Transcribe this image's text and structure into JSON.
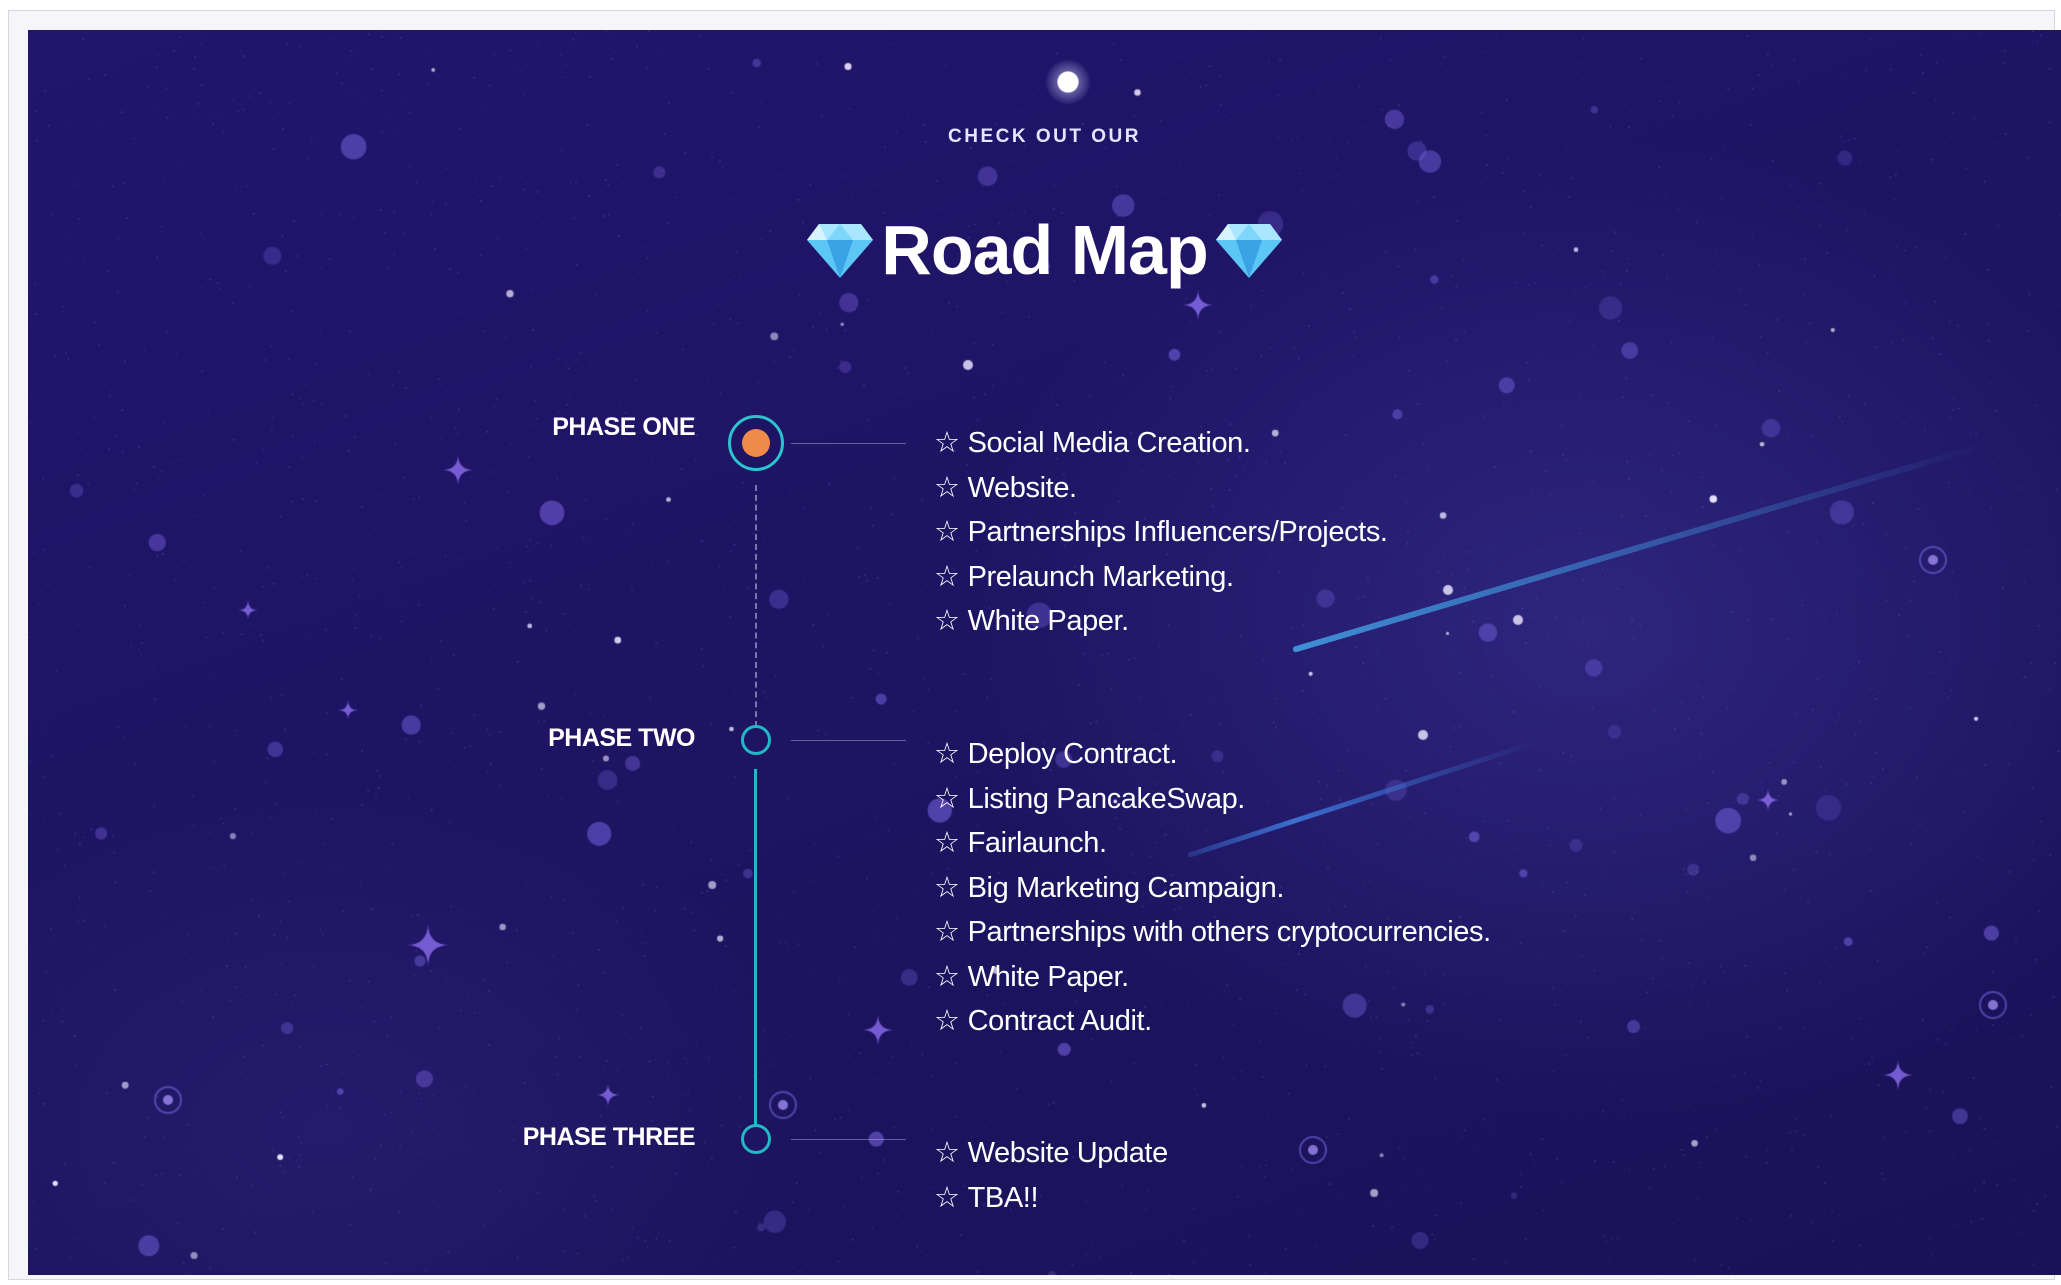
{
  "heading": {
    "kicker": "CHECK OUT OUR",
    "title": "Road Map",
    "decoration_icon": "diamond-icon"
  },
  "bullet_symbol": "☆",
  "colors": {
    "background": "#1e1463",
    "timeline_accent": "#22b8c4",
    "active_node": "#f08a4b",
    "text": "#ffffff"
  },
  "phases": [
    {
      "label": "PHASE ONE",
      "status": "active",
      "items": [
        "Social Media Creation.",
        "Website.",
        "Partnerships Influencers/Projects.",
        "Prelaunch Marketing.",
        "White Paper."
      ]
    },
    {
      "label": "PHASE TWO",
      "status": "upcoming",
      "items": [
        "Deploy Contract.",
        "Listing PancakeSwap.",
        "Fairlaunch.",
        "Big Marketing Campaign.",
        "Partnerships with others cryptocurrencies.",
        "White Paper.",
        "Contract Audit."
      ]
    },
    {
      "label": "PHASE THREE",
      "status": "upcoming",
      "items": [
        "Website Update",
        "TBA!!"
      ]
    }
  ]
}
